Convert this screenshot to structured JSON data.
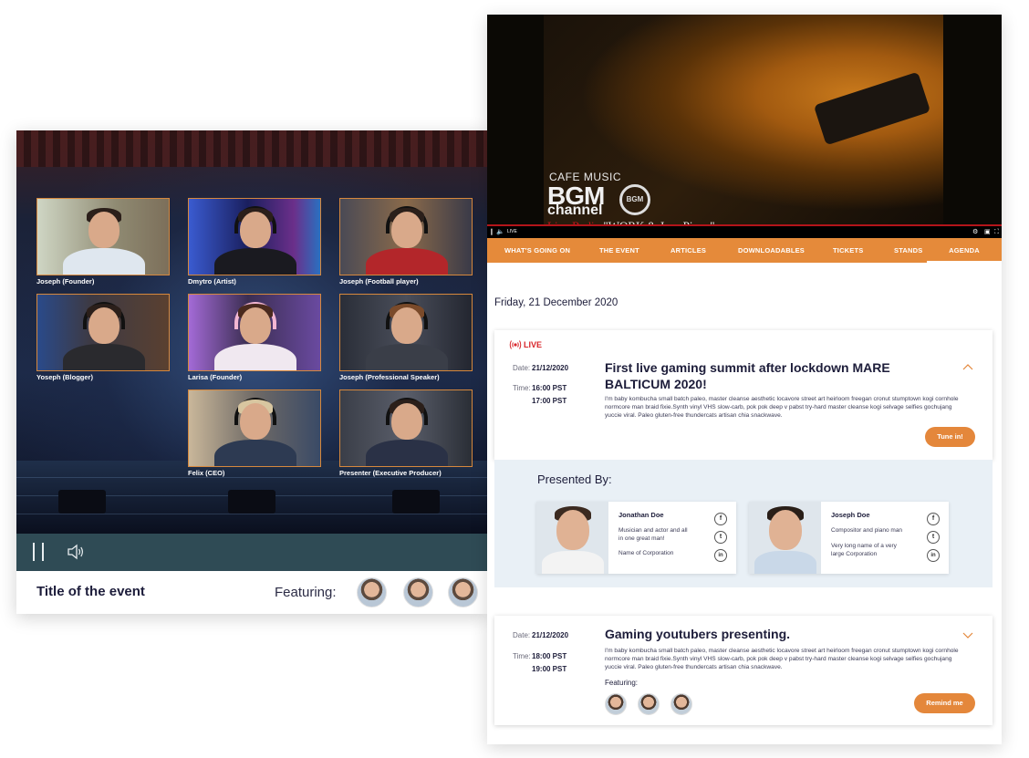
{
  "left_player": {
    "participants": [
      {
        "name": "Joseph (Founder)"
      },
      {
        "name": "Dmytro (Artist)"
      },
      {
        "name": "Joseph (Football player)"
      },
      {
        "name": "Yoseph (Blogger)"
      },
      {
        "name": "Larisa (Founder)"
      },
      {
        "name": "Joseph (Professional Speaker)"
      },
      {
        "name": "Felix (CEO)"
      },
      {
        "name": "Presenter (Executive Producer)"
      }
    ],
    "controls": {
      "pause_icon": "pause-icon",
      "volume_icon": "speaker-icon"
    },
    "event_title": "Title of the event",
    "featuring_label": "Featuring:"
  },
  "video": {
    "overlay_small": "CAFE MUSIC",
    "overlay_big": "BGM",
    "overlay_channel": "channel",
    "badge": "BGM",
    "subtitle_red": "Live Radio",
    "subtitle_white": " \"WORK & Jazz Piano\"",
    "controls_live": "LIVE"
  },
  "nav": {
    "items": [
      {
        "label": "WHAT'S GOING ON"
      },
      {
        "label": "THE EVENT"
      },
      {
        "label": "ARTICLES"
      },
      {
        "label": "DOWNLOADABLES"
      },
      {
        "label": "TICKETS"
      },
      {
        "label": "STANDS"
      },
      {
        "label": "AGENDA",
        "active": true
      }
    ]
  },
  "agenda": {
    "date_heading": "Friday, 21 December 2020",
    "sessions": [
      {
        "live_label": "LIVE",
        "date_label": "Date:",
        "date": "21/12/2020",
        "time_label": "Time:",
        "start": "16:00 PST",
        "end": "17:00 PST",
        "title": "First live gaming summit after lockdown MARE BALTICUM 2020!",
        "description": "I'm baby kombucha small batch paleo, master cleanse aesthetic locavore street art heirloom freegan cronut stumptown kogi cornhole normcore man braid fixie.Synth vinyl VHS slow-carb, pok pok deep v pabst try-hard master cleanse kogi selvage selfies gochujang yuccie viral. Paleo gluten-free thundercats artisan chia snackwave.",
        "cta": "Tune in!",
        "chevron": "chevron-up-icon"
      },
      {
        "date_label": "Date:",
        "date": "21/12/2020",
        "time_label": "Time:",
        "start": "18:00 PST",
        "end": "19:00 PST",
        "title": "Gaming youtubers presenting.",
        "description": "I'm baby kombucha small batch paleo, master cleanse aesthetic locavore street art heirloom freegan cronut stumptown kogi cornhole normcore man braid fixie.Synth vinyl VHS slow-carb, pok pok deep v pabst try-hard master cleanse kogi selvage selfies gochujang yuccie viral. Paleo gluten-free thundercats artisan chia snackwave.",
        "featuring_label": "Featuring:",
        "cta": "Remind me",
        "chevron": "chevron-down-icon"
      }
    ],
    "presented_by": {
      "title": "Presented By:",
      "presenters": [
        {
          "name": "Jonathan Doe",
          "description": "Musician and actor and all in one great man!",
          "corporation": "Name of Corporation"
        },
        {
          "name": "Joseph Doe",
          "description": "Compositor and piano man",
          "corporation": "Very long name of a very large Corporation"
        }
      ],
      "social": {
        "facebook": "f",
        "twitter": "t",
        "linkedin": "in"
      }
    }
  },
  "colors": {
    "accent": "#e4873b",
    "live": "#d8262b",
    "player_controls": "#2f4b55",
    "presented_bg": "#e9f0f6"
  }
}
